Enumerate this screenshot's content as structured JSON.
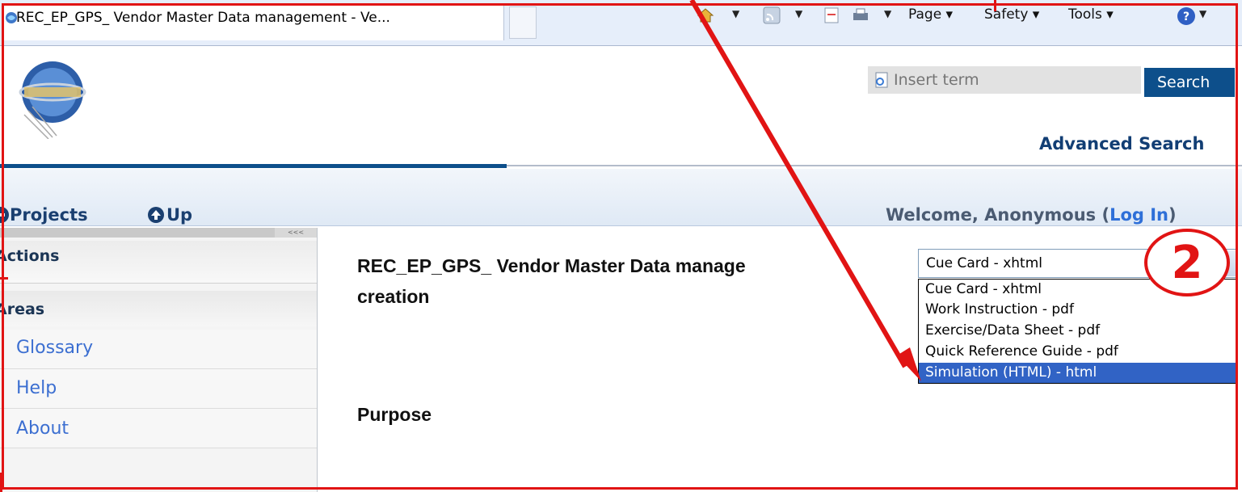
{
  "browser": {
    "tab_title": "REC_EP_GPS_ Vendor Master Data management - Ve...",
    "toolbar": {
      "page_label": "Page",
      "safety_label": "Safety",
      "tools_label": "Tools"
    }
  },
  "header": {
    "search_placeholder": "Insert term",
    "search_button": "Search",
    "advanced_search": "Advanced Search"
  },
  "nav": {
    "projects": "Projects",
    "up": "Up",
    "welcome": "Welcome, Anonymous (",
    "login": "Log In",
    "welcome_end": ")"
  },
  "sidebar": {
    "actions_label": "Actions",
    "areas_label": "Areas",
    "items": [
      {
        "label": "Glossary"
      },
      {
        "label": "Help"
      },
      {
        "label": "About"
      }
    ]
  },
  "content": {
    "title_line1": "REC_EP_GPS_ Vendor Master Data manage",
    "title_line2": "creation",
    "purpose": "Purpose"
  },
  "format_select": {
    "selected": "Cue Card - xhtml",
    "options": [
      "Cue Card - xhtml",
      "Work Instruction - pdf",
      "Exercise/Data Sheet - pdf",
      "Quick Reference Guide - pdf",
      "Simulation (HTML) - html"
    ],
    "highlighted": "Simulation (HTML) - html"
  },
  "annotation": {
    "step_number": "2"
  },
  "colors": {
    "brand_blue": "#0d4f8b",
    "link_blue": "#3c6fd1",
    "selection_blue": "#3163c5",
    "annotation_red": "#e11414"
  }
}
